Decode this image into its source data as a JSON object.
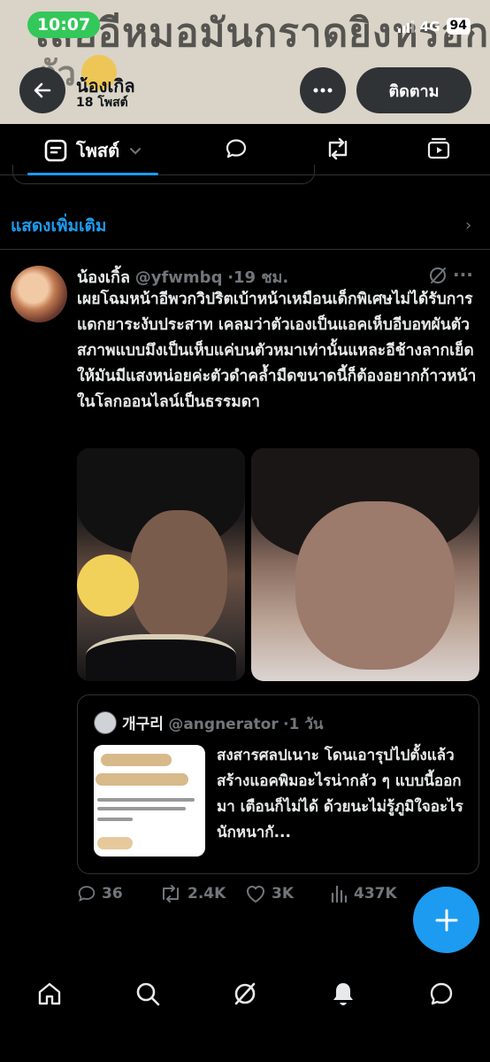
{
  "status_bar": {
    "time": "10:07",
    "network": "4G",
    "battery": "94"
  },
  "banner": {
    "text_line1": "เสียอีหมอมันกราดยิงหรอก",
    "text_line2": "ตัว"
  },
  "profile": {
    "name": "น้องเกิล",
    "post_count": "18 โพสต์",
    "follow_label": "ติดตาม"
  },
  "tabs": {
    "active_label": "โพสต์"
  },
  "show_more": "แสดงเพิ่มเติม",
  "tweet": {
    "name": "น้องเกิ้ล",
    "handle": "@yfwmbq",
    "time": "·19 ชม.",
    "text": "เผยโฉมหน้าอีพวกวิปริตเบ้าหน้าเหมือนเด็กพิเศษไม่ได้รับการแดกยาระงับประสาท เคลมว่าตัวเองเป็นแอคเห็บอีบอทผันตัว สภาพแบบมึงเป็นเห็บแค่บนตัวหมาเท่านั้นแหละอีช้างลากเย็ด ให้มันมีแสงหน่อยค่ะตัวดำคล้ำมืดขนาดนี้ก็ต้องอยากก้าวหน้าในโลกออนไลน์เป็นธรรมดา",
    "quote": {
      "name": "개구리",
      "handle": "@angnerator",
      "time": "·1 วัน",
      "text": "สงสารศลปเนาะ โดนเอารุปไปตั้งแล้วสร้างแอคพิมอะไรน่ากลัว ๆ แบบนี้ออกมา เตือนก็ไม่ได้ ด้วยนะไม่รู้ภูมิใจอะไรนักหนากั..."
    },
    "stats": {
      "replies": "36",
      "reposts": "2.4K",
      "likes": "3K",
      "views": "437K"
    }
  },
  "colors": {
    "accent": "#1d9bf0",
    "background": "#000000",
    "muted": "#71767b",
    "border": "#2f3336"
  }
}
